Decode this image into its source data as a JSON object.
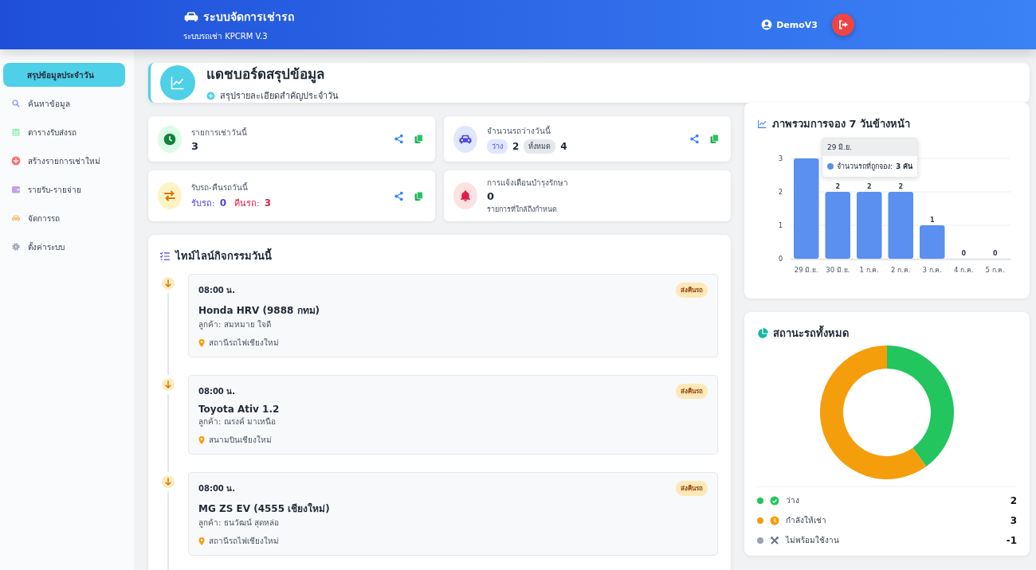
{
  "header": {
    "title": "ระบบจัดการเช่ารถ",
    "subtitle": "ระบบรถเช่า KPCRM V.3",
    "user": "DemoV3"
  },
  "sidebar": {
    "items": [
      {
        "label": "สรุปข้อมูลประจำวัน",
        "kind": "summary",
        "selected": true
      },
      {
        "label": "ค้นหาข้อมูล",
        "kind": "search",
        "selected": false
      },
      {
        "label": "ตารางรับส่งรถ",
        "kind": "calendar",
        "selected": false
      },
      {
        "label": "สร้างรายการเช่าใหม่",
        "kind": "create",
        "selected": false
      },
      {
        "label": "รายรับ-รายจ่าย",
        "kind": "wallet",
        "selected": false
      },
      {
        "label": "จัดการรถ",
        "kind": "car",
        "selected": false
      },
      {
        "label": "ตั้งค่าระบบ",
        "kind": "settings",
        "selected": false
      }
    ]
  },
  "page_header": {
    "title": "แดชบอร์ดสรุปข้อมูล",
    "subtitle": "สรุปรายละเอียดสำคัญประจำวัน"
  },
  "stat_cards": [
    {
      "kind": "rentals",
      "label": "รายการเช่าวันนี้",
      "value": "3",
      "actions": true
    },
    {
      "kind": "availability",
      "label": "จำนวนรถว่างวันนี้",
      "badges": [
        {
          "label": "ว่าง",
          "value": "2"
        },
        {
          "label": "ทั้งหมด",
          "value": "4"
        }
      ],
      "actions": true
    },
    {
      "kind": "transfers",
      "label": "รับรถ-คืนรถวันนี้",
      "pickup_label": "รับรถ:",
      "pickup": "0",
      "return_label": "คืนรถ:",
      "return": "3",
      "actions": true
    },
    {
      "kind": "alerts",
      "label": "การแจ้งเตือนบำรุงรักษา",
      "value": "0",
      "note": "รายการที่ใกล้ถึงกำหนด",
      "actions": false
    }
  ],
  "timeline": {
    "title": "ไทม์ไลน์กิจกรรมวันนี้",
    "items": [
      {
        "time": "08:00 น.",
        "vehicle": "Honda HRV (9888 กทม)",
        "customer": "ลูกค้า: สมหมาย ใจดี",
        "location": "สถานีรถไฟเชียงใหม่",
        "badge": "ส่งคืนรถ"
      },
      {
        "time": "08:00 น.",
        "vehicle": "Toyota Ativ 1.2",
        "customer": "ลูกค้า: ณรงค์ มาเหนือ",
        "location": "สนามบินเชียงใหม่",
        "badge": "ส่งคืนรถ"
      },
      {
        "time": "08:00 น.",
        "vehicle": "MG ZS EV (4555 เชียงใหม่)",
        "customer": "ลูกค้า: ธนวัฒน์ สุดหล่อ",
        "location": "สถานีรถไฟเชียงใหม่",
        "badge": "ส่งคืนรถ"
      }
    ]
  },
  "booking_chart": {
    "title": "ภาพรวมการจอง 7 วันข้างหน้า",
    "chart_data": {
      "type": "bar",
      "categories": [
        "29 มิ.ย.",
        "30 มิ.ย.",
        "1 ก.ค.",
        "2 ก.ค.",
        "3 ก.ค.",
        "4 ก.ค.",
        "5 ก.ค."
      ],
      "values": [
        3,
        2,
        2,
        2,
        1,
        0,
        0
      ],
      "ylim": [
        0,
        3
      ],
      "yticks": [
        0,
        1,
        2,
        3
      ],
      "value_labels": [
        null,
        "2",
        "2",
        "2",
        "1",
        "0",
        "0"
      ]
    },
    "tooltip": {
      "title": "29 มิ.ย.",
      "label": "จำนวนรถที่ถูกจอง:",
      "value": "3 คัน"
    }
  },
  "vehicle_status": {
    "title": "สถานะรถทั้งหมด",
    "items": [
      {
        "kind": "available",
        "label": "ว่าง",
        "count": "2",
        "color": "#22c55e"
      },
      {
        "kind": "rented",
        "label": "กำลังให้เช่า",
        "count": "3",
        "color": "#f59e0b"
      },
      {
        "kind": "unavailable",
        "label": "ไม่พร้อมใช้งาน",
        "count": "-1",
        "color": "#9ca3af"
      }
    ]
  }
}
